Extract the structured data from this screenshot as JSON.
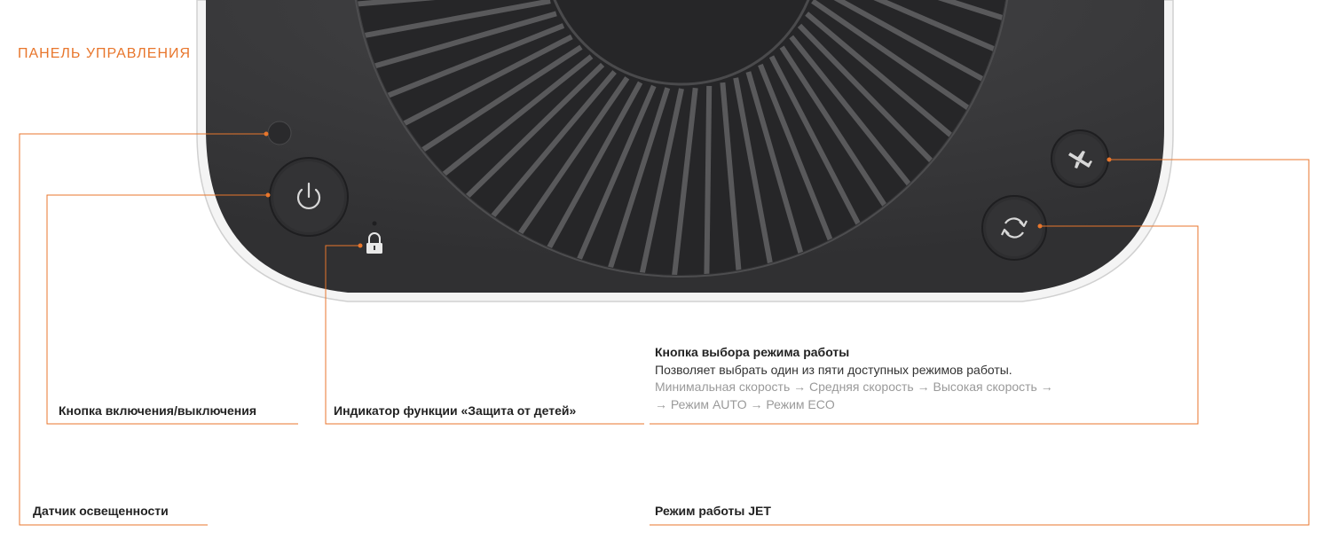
{
  "section_title": "ПАНЕЛЬ УПРАВЛЕНИЯ",
  "labels": {
    "light_sensor": "Датчик освещенности",
    "power_button": "Кнопка включения/выключения",
    "child_lock": "Индикатор функции «Защита от детей»",
    "jet_mode": "Режим работы JET"
  },
  "mode_button": {
    "title": "Кнопка выбора режима работы",
    "description": "Позволяет выбрать один из пяти доступных режимов работы.",
    "sequence_line1": "Минимальная скорость → Средняя скорость → Высокая скорость →",
    "sequence_line2": "→ Режим AUTO → Режим ECO"
  },
  "colors": {
    "accent": "#e8762c",
    "device_body": "#3a3a3c",
    "device_rim": "#e6e6e6",
    "button": "#2e2e30"
  },
  "icons": [
    "power-icon",
    "lock-icon",
    "cycle-icon",
    "airplane-icon",
    "light-sensor-icon"
  ]
}
